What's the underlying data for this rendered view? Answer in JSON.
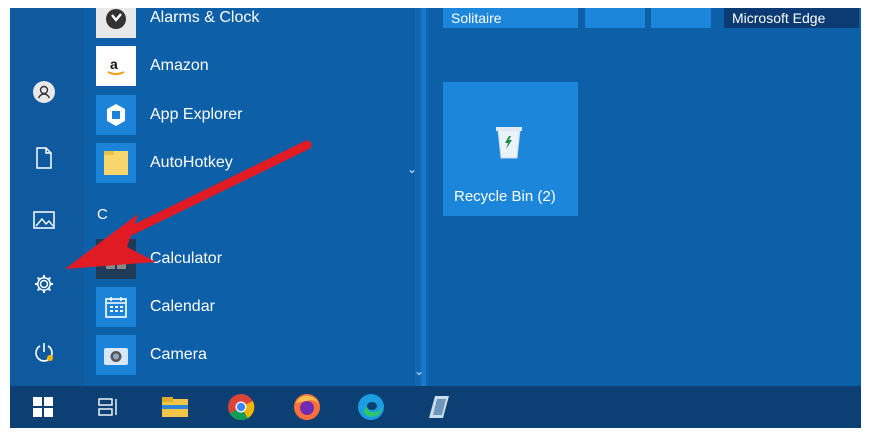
{
  "start_menu": {
    "top_tiles": {
      "solitaire": "Solitaire",
      "edge": "Microsoft Edge"
    },
    "apps": [
      {
        "label": "Alarms & Clock",
        "icon": "alarm-clock-icon"
      },
      {
        "label": "Amazon",
        "icon": "amazon-icon"
      },
      {
        "label": "App Explorer",
        "icon": "app-explorer-icon"
      },
      {
        "label": "AutoHotkey",
        "icon": "folder-icon"
      },
      {
        "label": "Calculator",
        "icon": "calculator-icon"
      },
      {
        "label": "Calendar",
        "icon": "calendar-icon"
      },
      {
        "label": "Camera",
        "icon": "camera-icon"
      }
    ],
    "section_letter": "C",
    "recycle_tile": {
      "label": "Recycle Bin (2)",
      "icon": "recycle-bin-icon"
    }
  },
  "rail_icons": [
    "user-icon",
    "document-icon",
    "pictures-icon",
    "settings-gear-icon",
    "power-icon"
  ],
  "taskbar_icons": [
    "windows-start-icon",
    "task-view-icon",
    "file-explorer-icon",
    "chrome-icon",
    "firefox-icon",
    "edge-icon",
    "app-icon"
  ],
  "colors": {
    "start_bg": "#0d5fa7",
    "tile": "#1c86db",
    "taskbar": "#0c3f73",
    "arrow": "#e01b24"
  }
}
